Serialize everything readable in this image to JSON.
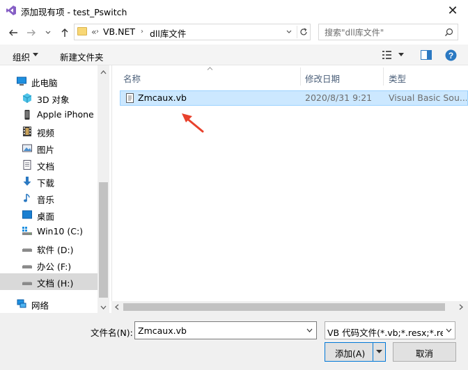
{
  "window": {
    "title": "添加现有项 - test_Pswitch"
  },
  "address": {
    "overflow": "«",
    "segments": [
      "VB.NET",
      "dll库文件"
    ]
  },
  "search": {
    "placeholder": "搜索\"dll库文件\""
  },
  "toolbar": {
    "organize": "组织",
    "new_folder": "新建文件夹"
  },
  "navpane": {
    "items": [
      {
        "label": "此电脑",
        "icon": "computer-icon"
      },
      {
        "label": "3D 对象",
        "icon": "3d-objects-icon"
      },
      {
        "label": "Apple iPhone",
        "icon": "iphone-icon"
      },
      {
        "label": "视频",
        "icon": "video-icon"
      },
      {
        "label": "图片",
        "icon": "pictures-icon"
      },
      {
        "label": "文档",
        "icon": "documents-icon"
      },
      {
        "label": "下载",
        "icon": "downloads-icon"
      },
      {
        "label": "音乐",
        "icon": "music-icon"
      },
      {
        "label": "桌面",
        "icon": "desktop-icon"
      },
      {
        "label": "Win10 (C:)",
        "icon": "drive-icon"
      },
      {
        "label": "软件 (D:)",
        "icon": "drive-icon"
      },
      {
        "label": "办公 (F:)",
        "icon": "drive-icon"
      },
      {
        "label": "文档 (H:)",
        "icon": "drive-icon"
      },
      {
        "label": "网络",
        "icon": "network-icon"
      }
    ]
  },
  "filelist": {
    "columns": [
      "名称",
      "修改日期",
      "类型"
    ],
    "rows": [
      {
        "name": "Zmcaux.vb",
        "modified": "2020/8/31 9:21",
        "type": "Visual Basic Sou..."
      }
    ]
  },
  "bottom": {
    "filename_label": "文件名(N):",
    "filename_value": "Zmcaux.vb",
    "filter_value": "VB 代码文件(*.vb;*.resx;*.resw",
    "add_label": "添加(A)",
    "cancel_label": "取消"
  },
  "colors": {
    "accent": "#0078d7",
    "selection": "#cce8ff",
    "arrow": "#e8412c"
  }
}
